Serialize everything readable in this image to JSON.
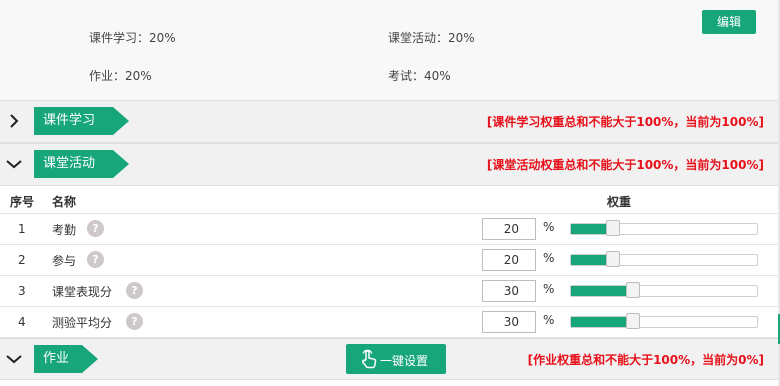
{
  "summary": {
    "items": [
      {
        "label": "课件学习：20%"
      },
      {
        "label": "课堂活动：20%"
      },
      {
        "label": "作业：20%"
      },
      {
        "label": "考试：40%"
      }
    ],
    "edit_label": "编辑"
  },
  "sections": [
    {
      "title": "课件学习",
      "collapsed": true,
      "warning": "[课件学习权重总和不能大于100%，当前为100%]"
    },
    {
      "title": "课堂活动",
      "collapsed": false,
      "warning": "[课堂活动权重总和不能大于100%，当前为100%]"
    },
    {
      "title": "作业",
      "collapsed": false,
      "warning": "[作业权重总和不能大于100%，当前为0%]",
      "action_label": "一键设置"
    }
  ],
  "table": {
    "headers": {
      "index": "序号",
      "name": "名称",
      "weight": "权重"
    },
    "help_glyph": "?",
    "percent_sign": "%",
    "rows": [
      {
        "index": "1",
        "name": "考勤",
        "weight": "20",
        "level": 0.2
      },
      {
        "index": "2",
        "name": "参与",
        "weight": "20",
        "level": 0.2
      },
      {
        "index": "3",
        "name": "课堂表现分",
        "weight": "30",
        "level": 0.3
      },
      {
        "index": "4",
        "name": "测验平均分",
        "weight": "30",
        "level": 0.3
      }
    ]
  },
  "colors": {
    "accent": "#17a67a",
    "warning": "#e8101a"
  },
  "icons": {
    "collapsed": "chevron-right-icon",
    "expanded": "chevron-down-icon",
    "help": "help-icon",
    "one_key": "hand-pointer-icon"
  }
}
